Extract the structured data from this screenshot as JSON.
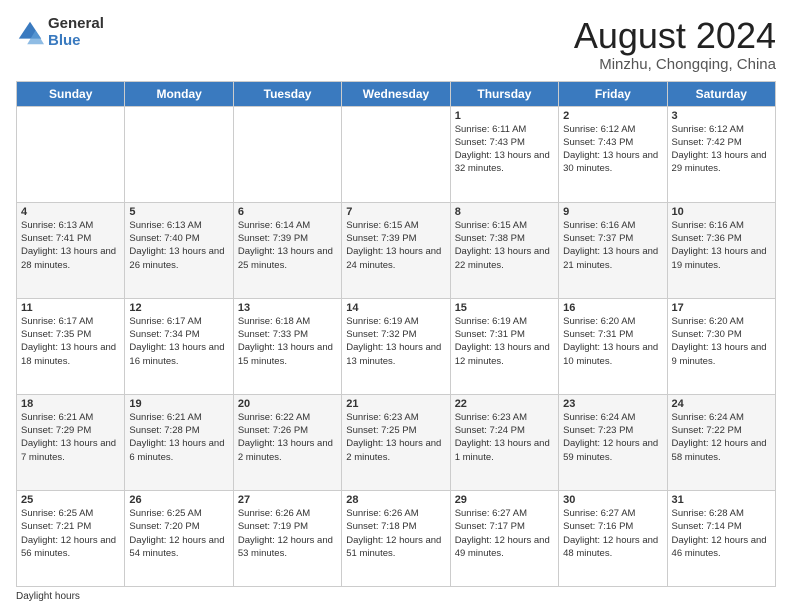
{
  "logo": {
    "general": "General",
    "blue": "Blue"
  },
  "title": {
    "month_year": "August 2024",
    "location": "Minzhu, Chongqing, China"
  },
  "days_of_week": [
    "Sunday",
    "Monday",
    "Tuesday",
    "Wednesday",
    "Thursday",
    "Friday",
    "Saturday"
  ],
  "weeks": [
    [
      {
        "day": "",
        "info": ""
      },
      {
        "day": "",
        "info": ""
      },
      {
        "day": "",
        "info": ""
      },
      {
        "day": "",
        "info": ""
      },
      {
        "day": "1",
        "info": "Sunrise: 6:11 AM\nSunset: 7:43 PM\nDaylight: 13 hours\nand 32 minutes."
      },
      {
        "day": "2",
        "info": "Sunrise: 6:12 AM\nSunset: 7:43 PM\nDaylight: 13 hours\nand 30 minutes."
      },
      {
        "day": "3",
        "info": "Sunrise: 6:12 AM\nSunset: 7:42 PM\nDaylight: 13 hours\nand 29 minutes."
      }
    ],
    [
      {
        "day": "4",
        "info": "Sunrise: 6:13 AM\nSunset: 7:41 PM\nDaylight: 13 hours\nand 28 minutes."
      },
      {
        "day": "5",
        "info": "Sunrise: 6:13 AM\nSunset: 7:40 PM\nDaylight: 13 hours\nand 26 minutes."
      },
      {
        "day": "6",
        "info": "Sunrise: 6:14 AM\nSunset: 7:39 PM\nDaylight: 13 hours\nand 25 minutes."
      },
      {
        "day": "7",
        "info": "Sunrise: 6:15 AM\nSunset: 7:39 PM\nDaylight: 13 hours\nand 24 minutes."
      },
      {
        "day": "8",
        "info": "Sunrise: 6:15 AM\nSunset: 7:38 PM\nDaylight: 13 hours\nand 22 minutes."
      },
      {
        "day": "9",
        "info": "Sunrise: 6:16 AM\nSunset: 7:37 PM\nDaylight: 13 hours\nand 21 minutes."
      },
      {
        "day": "10",
        "info": "Sunrise: 6:16 AM\nSunset: 7:36 PM\nDaylight: 13 hours\nand 19 minutes."
      }
    ],
    [
      {
        "day": "11",
        "info": "Sunrise: 6:17 AM\nSunset: 7:35 PM\nDaylight: 13 hours\nand 18 minutes."
      },
      {
        "day": "12",
        "info": "Sunrise: 6:17 AM\nSunset: 7:34 PM\nDaylight: 13 hours\nand 16 minutes."
      },
      {
        "day": "13",
        "info": "Sunrise: 6:18 AM\nSunset: 7:33 PM\nDaylight: 13 hours\nand 15 minutes."
      },
      {
        "day": "14",
        "info": "Sunrise: 6:19 AM\nSunset: 7:32 PM\nDaylight: 13 hours\nand 13 minutes."
      },
      {
        "day": "15",
        "info": "Sunrise: 6:19 AM\nSunset: 7:31 PM\nDaylight: 13 hours\nand 12 minutes."
      },
      {
        "day": "16",
        "info": "Sunrise: 6:20 AM\nSunset: 7:31 PM\nDaylight: 13 hours\nand 10 minutes."
      },
      {
        "day": "17",
        "info": "Sunrise: 6:20 AM\nSunset: 7:30 PM\nDaylight: 13 hours\nand 9 minutes."
      }
    ],
    [
      {
        "day": "18",
        "info": "Sunrise: 6:21 AM\nSunset: 7:29 PM\nDaylight: 13 hours\nand 7 minutes."
      },
      {
        "day": "19",
        "info": "Sunrise: 6:21 AM\nSunset: 7:28 PM\nDaylight: 13 hours\nand 6 minutes."
      },
      {
        "day": "20",
        "info": "Sunrise: 6:22 AM\nSunset: 7:26 PM\nDaylight: 13 hours\nand 2 minutes."
      },
      {
        "day": "21",
        "info": "Sunrise: 6:23 AM\nSunset: 7:25 PM\nDaylight: 13 hours\nand 2 minutes."
      },
      {
        "day": "22",
        "info": "Sunrise: 6:23 AM\nSunset: 7:24 PM\nDaylight: 13 hours\nand 1 minute."
      },
      {
        "day": "23",
        "info": "Sunrise: 6:24 AM\nSunset: 7:23 PM\nDaylight: 12 hours\nand 59 minutes."
      },
      {
        "day": "24",
        "info": "Sunrise: 6:24 AM\nSunset: 7:22 PM\nDaylight: 12 hours\nand 58 minutes."
      }
    ],
    [
      {
        "day": "25",
        "info": "Sunrise: 6:25 AM\nSunset: 7:21 PM\nDaylight: 12 hours\nand 56 minutes."
      },
      {
        "day": "26",
        "info": "Sunrise: 6:25 AM\nSunset: 7:20 PM\nDaylight: 12 hours\nand 54 minutes."
      },
      {
        "day": "27",
        "info": "Sunrise: 6:26 AM\nSunset: 7:19 PM\nDaylight: 12 hours\nand 53 minutes."
      },
      {
        "day": "28",
        "info": "Sunrise: 6:26 AM\nSunset: 7:18 PM\nDaylight: 12 hours\nand 51 minutes."
      },
      {
        "day": "29",
        "info": "Sunrise: 6:27 AM\nSunset: 7:17 PM\nDaylight: 12 hours\nand 49 minutes."
      },
      {
        "day": "30",
        "info": "Sunrise: 6:27 AM\nSunset: 7:16 PM\nDaylight: 12 hours\nand 48 minutes."
      },
      {
        "day": "31",
        "info": "Sunrise: 6:28 AM\nSunset: 7:14 PM\nDaylight: 12 hours\nand 46 minutes."
      }
    ]
  ],
  "footer": {
    "label": "Daylight hours"
  }
}
